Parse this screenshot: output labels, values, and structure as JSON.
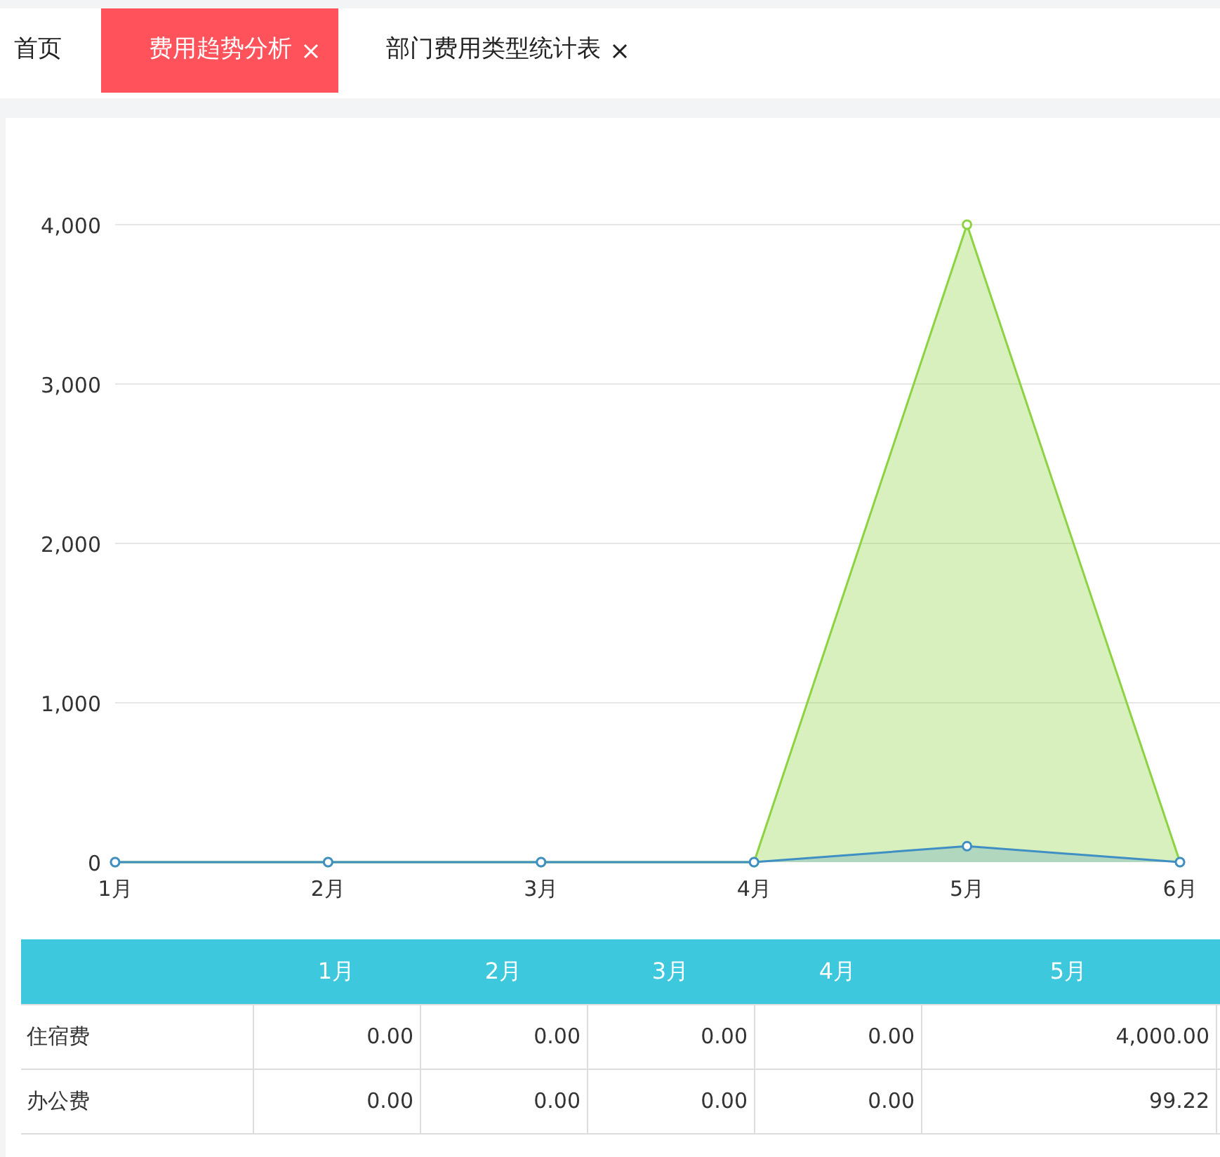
{
  "tabs": [
    {
      "label": "首页",
      "selected": false,
      "closable": false
    },
    {
      "label": "费用趋势分析",
      "selected": true,
      "closable": true
    },
    {
      "label": "部门费用类型统计表",
      "selected": false,
      "closable": true
    }
  ],
  "chart_data": {
    "type": "area",
    "grid": true,
    "ylim": [
      0,
      4000
    ],
    "categories": [
      "1月",
      "2月",
      "3月",
      "4月",
      "5月",
      "6月"
    ],
    "yticks": [
      {
        "value": 0,
        "label": "0"
      },
      {
        "value": 1000,
        "label": "1,000"
      },
      {
        "value": 2000,
        "label": "2,000"
      },
      {
        "value": 3000,
        "label": "3,000"
      },
      {
        "value": 4000,
        "label": "4,000"
      }
    ],
    "series": [
      {
        "color": "#8cd342",
        "values": [
          0,
          0,
          0,
          0,
          4000,
          0
        ]
      },
      {
        "color": "#3f8fc4",
        "values": [
          0,
          0,
          0,
          0,
          100,
          0
        ]
      }
    ]
  },
  "table": {
    "columns": [
      "1月",
      "2月",
      "3月",
      "4月",
      "5月"
    ],
    "rows": [
      {
        "label": "住宿费",
        "cells": [
          "0.00",
          "0.00",
          "0.00",
          "0.00",
          "4,000.00"
        ]
      },
      {
        "label": "办公费",
        "cells": [
          "0.00",
          "0.00",
          "0.00",
          "0.00",
          "99.22"
        ]
      }
    ]
  }
}
